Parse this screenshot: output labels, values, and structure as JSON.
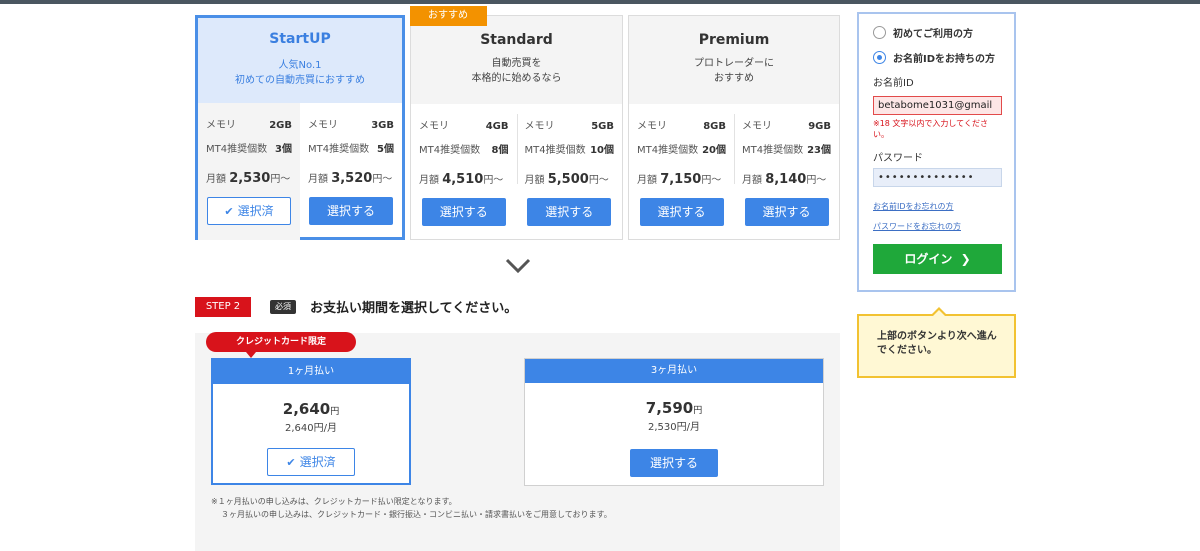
{
  "plans": [
    {
      "name": "StartUP",
      "desc1": "人気No.1",
      "desc2": "初めての自動売買におすすめ",
      "options": [
        {
          "memory_label": "メモリ",
          "memory": "2GB",
          "count_label": "MT4推奨個数",
          "count": "3個",
          "price_prefix": "月額",
          "price": "2,530",
          "price_suffix": "円～",
          "button": "選択済"
        },
        {
          "memory_label": "メモリ",
          "memory": "3GB",
          "count_label": "MT4推奨個数",
          "count": "5個",
          "price_prefix": "月額",
          "price": "3,520",
          "price_suffix": "円～",
          "button": "選択する"
        }
      ]
    },
    {
      "name": "Standard",
      "desc1": "自動売買を",
      "desc2": "本格的に始めるなら",
      "badge": "おすすめ",
      "options": [
        {
          "memory_label": "メモリ",
          "memory": "4GB",
          "count_label": "MT4推奨個数",
          "count": "8個",
          "price_prefix": "月額",
          "price": "4,510",
          "price_suffix": "円～",
          "button": "選択する"
        },
        {
          "memory_label": "メモリ",
          "memory": "5GB",
          "count_label": "MT4推奨個数",
          "count": "10個",
          "price_prefix": "月額",
          "price": "5,500",
          "price_suffix": "円～",
          "button": "選択する"
        }
      ]
    },
    {
      "name": "Premium",
      "desc1": "プロトレーダーに",
      "desc2": "おすすめ",
      "options": [
        {
          "memory_label": "メモリ",
          "memory": "8GB",
          "count_label": "MT4推奨個数",
          "count": "20個",
          "price_prefix": "月額",
          "price": "7,150",
          "price_suffix": "円～",
          "button": "選択する"
        },
        {
          "memory_label": "メモリ",
          "memory": "9GB",
          "count_label": "MT4推奨個数",
          "count": "23個",
          "price_prefix": "月額",
          "price": "8,140",
          "price_suffix": "円～",
          "button": "選択する"
        }
      ]
    }
  ],
  "step2": {
    "badge": "STEP 2",
    "required": "必須",
    "title": "お支払い期間を選択してください。",
    "card_only": "クレジットカード限定",
    "options": [
      {
        "period": "1ヶ月払い",
        "amount": "2,640",
        "unit": "円",
        "monthly": "2,640円/月",
        "button": "選択済"
      },
      {
        "period": "3ヶ月払い",
        "amount": "7,590",
        "unit": "円",
        "monthly": "2,530円/月",
        "button": "選択する"
      }
    ],
    "note1": "※１ヶ月払いの申し込みは、クレジットカード払い限定となります。",
    "note2": "３ヶ月払いの申し込みは、クレジットカード・銀行振込・コンビニ払い・請求書払いをご用意しております。"
  },
  "login": {
    "radio_first": "初めてご利用の方",
    "radio_existing": "お名前IDをお持ちの方",
    "id_label": "お名前ID",
    "id_value": "betabome1031@gmail",
    "error": "※18 文字以内で入力してください。",
    "password_label": "パスワード",
    "password_value": "••••••••••••••",
    "forgot_id": "お名前IDをお忘れの方",
    "forgot_password": "パスワードをお忘れの方",
    "login_button": "ログイン"
  },
  "tip": "上部のボタンより次へ進んでください。"
}
